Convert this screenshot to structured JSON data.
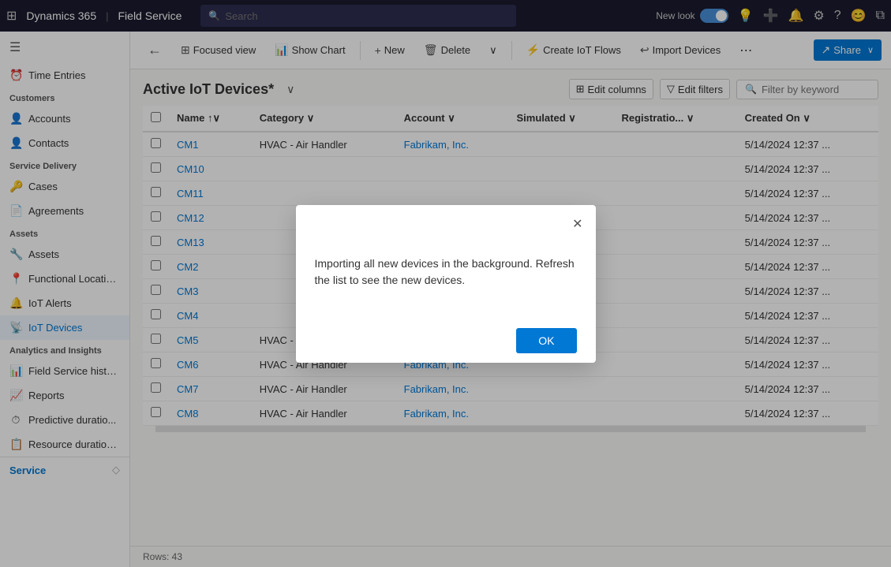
{
  "topNav": {
    "appName": "Dynamics 365",
    "divider": "|",
    "moduleName": "Field Service",
    "searchPlaceholder": "Search",
    "newLookLabel": "New look"
  },
  "sidebar": {
    "hamburgerIcon": "☰",
    "timeEntries": "Time Entries",
    "sections": [
      {
        "label": "Customers",
        "items": [
          {
            "icon": "👤",
            "label": "Accounts"
          },
          {
            "icon": "👤",
            "label": "Contacts"
          }
        ]
      },
      {
        "label": "Service Delivery",
        "items": [
          {
            "icon": "🔑",
            "label": "Cases"
          },
          {
            "icon": "📄",
            "label": "Agreements"
          }
        ]
      },
      {
        "label": "Assets",
        "items": [
          {
            "icon": "🔧",
            "label": "Assets"
          },
          {
            "icon": "📍",
            "label": "Functional Locatio..."
          },
          {
            "icon": "🔔",
            "label": "IoT Alerts"
          },
          {
            "icon": "📡",
            "label": "IoT Devices",
            "active": true
          }
        ]
      },
      {
        "label": "Analytics and Insights",
        "items": [
          {
            "icon": "📊",
            "label": "Field Service histo..."
          },
          {
            "icon": "📈",
            "label": "Reports"
          },
          {
            "icon": "⏱",
            "label": "Predictive duratio..."
          },
          {
            "icon": "📋",
            "label": "Resource duration..."
          }
        ]
      }
    ],
    "bottomLabel": "Service",
    "bottomIcon": "◇"
  },
  "toolbar": {
    "backIcon": "←",
    "focusedViewIcon": "⊞",
    "focusedViewLabel": "Focused view",
    "showChartIcon": "📊",
    "showChartLabel": "Show Chart",
    "newIcon": "+",
    "newLabel": "New",
    "deleteIcon": "🗑",
    "deleteLabel": "Delete",
    "chevronIcon": "∨",
    "createIoTFlowsIcon": "⚡",
    "createIoTFlowsLabel": "Create IoT Flows",
    "importDevicesIcon": "↩",
    "importDevicesLabel": "Import Devices",
    "moreIcon": "⋯",
    "shareIcon": "↗",
    "shareLabel": "Share",
    "shareChevron": "∨"
  },
  "listView": {
    "title": "Active IoT Devices*",
    "dropdownIcon": "∨",
    "editColumnsLabel": "Edit columns",
    "editColumnsIcon": "⊞",
    "editFiltersLabel": "Edit filters",
    "editFiltersIcon": "▽",
    "filterPlaceholder": "Filter by keyword",
    "filterIcon": "🔍",
    "columns": [
      {
        "label": "Name",
        "sortIcon": "↑∨"
      },
      {
        "label": "Category",
        "sortIcon": "∨"
      },
      {
        "label": "Account",
        "sortIcon": "∨"
      },
      {
        "label": "Simulated",
        "sortIcon": "∨"
      },
      {
        "label": "Registratio...",
        "sortIcon": "∨"
      },
      {
        "label": "Created On",
        "sortIcon": "∨"
      }
    ],
    "rows": [
      {
        "name": "CM1",
        "category": "HVAC - Air Handler",
        "account": "Fabrikam, Inc.",
        "simulated": "",
        "registration": "",
        "createdOn": "5/14/2024 12:37 ..."
      },
      {
        "name": "CM10",
        "category": "",
        "account": "",
        "simulated": "",
        "registration": "",
        "createdOn": "5/14/2024 12:37 ..."
      },
      {
        "name": "CM11",
        "category": "",
        "account": "",
        "simulated": "",
        "registration": "",
        "createdOn": "5/14/2024 12:37 ..."
      },
      {
        "name": "CM12",
        "category": "",
        "account": "",
        "simulated": "",
        "registration": "",
        "createdOn": "5/14/2024 12:37 ..."
      },
      {
        "name": "CM13",
        "category": "",
        "account": "",
        "simulated": "",
        "registration": "",
        "createdOn": "5/14/2024 12:37 ..."
      },
      {
        "name": "CM2",
        "category": "",
        "account": "",
        "simulated": "",
        "registration": "",
        "createdOn": "5/14/2024 12:37 ..."
      },
      {
        "name": "CM3",
        "category": "",
        "account": "",
        "simulated": "",
        "registration": "",
        "createdOn": "5/14/2024 12:37 ..."
      },
      {
        "name": "CM4",
        "category": "",
        "account": "",
        "simulated": "",
        "registration": "",
        "createdOn": "5/14/2024 12:37 ..."
      },
      {
        "name": "CM5",
        "category": "HVAC - Air Handler",
        "account": "Fabrikam, Inc.",
        "simulated": "",
        "registration": "",
        "createdOn": "5/14/2024 12:37 ..."
      },
      {
        "name": "CM6",
        "category": "HVAC - Air Handler",
        "account": "Fabrikam, Inc.",
        "simulated": "",
        "registration": "",
        "createdOn": "5/14/2024 12:37 ..."
      },
      {
        "name": "CM7",
        "category": "HVAC - Air Handler",
        "account": "Fabrikam, Inc.",
        "simulated": "",
        "registration": "",
        "createdOn": "5/14/2024 12:37 ..."
      },
      {
        "name": "CM8",
        "category": "HVAC - Air Handler",
        "account": "Fabrikam, Inc.",
        "simulated": "",
        "registration": "",
        "createdOn": "5/14/2024 12:37 ..."
      }
    ],
    "rowsCount": "Rows: 43"
  },
  "modal": {
    "message": "Importing all new devices in the background. Refresh the list to see the new devices.",
    "okLabel": "OK",
    "closeIcon": "✕"
  }
}
